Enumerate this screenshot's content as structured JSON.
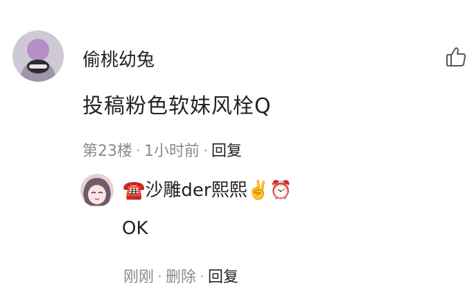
{
  "comment": {
    "username": "偷桃幼兔",
    "content": "投稿粉色软妹风栓Q",
    "floor": "第23楼",
    "time": "1小时前",
    "reply_label": "回复",
    "like_icon": "thumbs-up-icon"
  },
  "sub_reply": {
    "emoji_prefix": "☎️",
    "username": "沙雕der熙熙",
    "emoji_suffix": "✌️⏰",
    "content": "OK",
    "time": "刚刚",
    "delete_label": "删除",
    "reply_label": "回复"
  },
  "separator": "·"
}
